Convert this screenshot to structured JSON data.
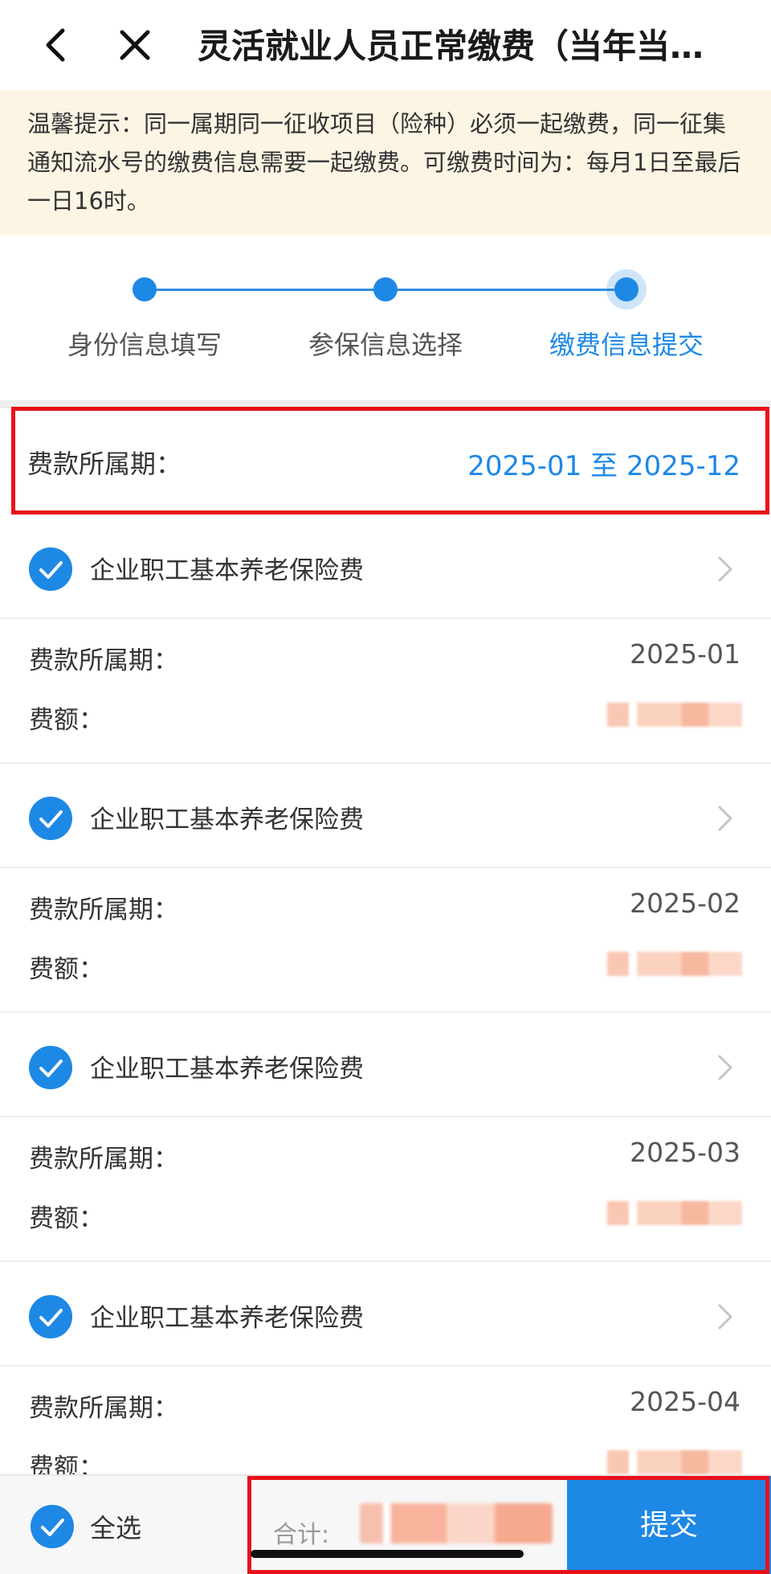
{
  "header": {
    "title": "灵活就业人员正常缴费（当年当…",
    "back_icon": "chevron-left-icon",
    "close_icon": "close-icon"
  },
  "notice": {
    "text": "温馨提示：同一属期同一征收项目（险种）必须一起缴费，同一征集通知流水号的缴费信息需要一起缴费。可缴费时间为：每月1日至最后一日16时。"
  },
  "steps": [
    {
      "label": "身份信息填写",
      "active": false
    },
    {
      "label": "参保信息选择",
      "active": false
    },
    {
      "label": "缴费信息提交",
      "active": true
    }
  ],
  "summary": {
    "period_label": "费款所属期：",
    "period_value": "2025-01 至 2025-12"
  },
  "items": [
    {
      "title": "企业职工基本养老保险费",
      "period_label": "费款所属期：",
      "period": "2025-01",
      "amount_label": "费额："
    },
    {
      "title": "企业职工基本养老保险费",
      "period_label": "费款所属期：",
      "period": "2025-02",
      "amount_label": "费额："
    },
    {
      "title": "企业职工基本养老保险费",
      "period_label": "费款所属期：",
      "period": "2025-03",
      "amount_label": "费额："
    },
    {
      "title": "企业职工基本养老保险费",
      "period_label": "费款所属期：",
      "period": "2025-04",
      "amount_label": "费额："
    }
  ],
  "footer": {
    "select_all": "全选",
    "total_label": "合计:",
    "submit": "提交"
  },
  "colors": {
    "accent": "#1e88e5",
    "highlight": "#e8111b",
    "notice_bg": "#fdf5e4"
  }
}
